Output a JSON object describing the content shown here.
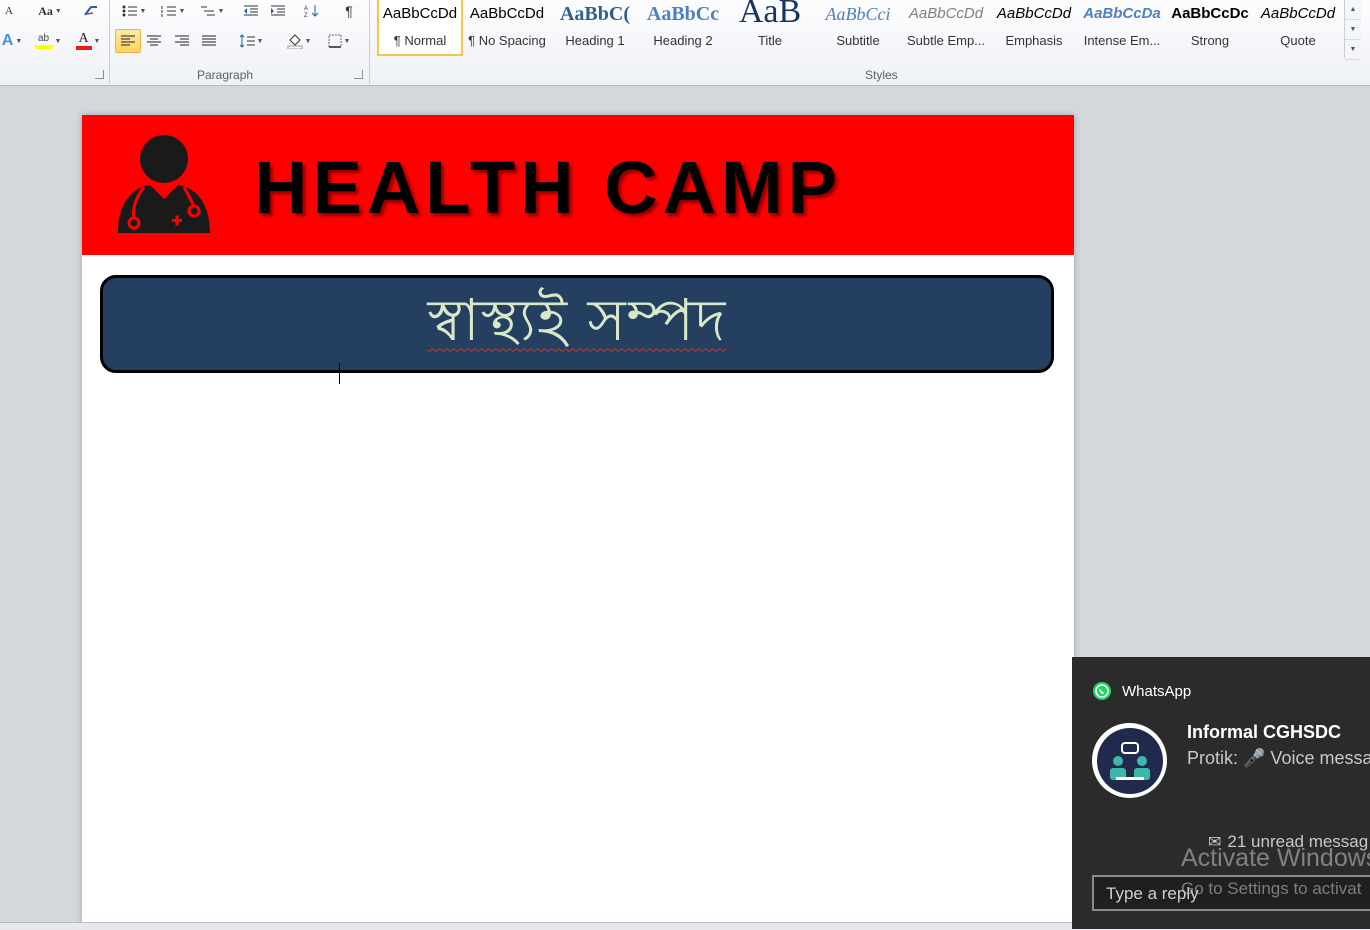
{
  "ribbon": {
    "paragraph_group_label": "Paragraph",
    "styles_group_label": "Styles",
    "font_tool_labels": {
      "grow_font": "A",
      "change_case": "Aa",
      "highlight": "ab",
      "font_color": "A",
      "pilcrow": "¶"
    },
    "styles": [
      {
        "sample": "AaBbCcDd",
        "name": "¶ Normal"
      },
      {
        "sample": "AaBbCcDd",
        "name": "¶ No Spacing"
      },
      {
        "sample": "AaBbC(",
        "name": "Heading 1"
      },
      {
        "sample": "AaBbCc",
        "name": "Heading 2"
      },
      {
        "sample": "AaB",
        "name": "Title"
      },
      {
        "sample": "AaBbCci",
        "name": "Subtitle"
      },
      {
        "sample": "AaBbCcDd",
        "name": "Subtle Emp..."
      },
      {
        "sample": "AaBbCcDd",
        "name": "Emphasis"
      },
      {
        "sample": "AaBbCcDa",
        "name": "Intense Em..."
      },
      {
        "sample": "AaBbCcDc",
        "name": "Strong"
      },
      {
        "sample": "AaBbCcDd",
        "name": "Quote"
      }
    ],
    "selected_style": "¶ Normal"
  },
  "document": {
    "banner_title": "HEALTH CAMP",
    "motto": "স্বাস্থ্যই সম্পদ",
    "colors": {
      "banner_bg": "#ff0000",
      "motto_box_bg": "#243f60",
      "motto_text": "#d8e8c8"
    },
    "icons": {
      "banner": "doctor-icon"
    }
  },
  "notification": {
    "app_name": "WhatsApp",
    "title": "Informal CGHSDC",
    "message": "Protik: 🎤 Voice messa",
    "unread": "21 unread messag",
    "reply_placeholder": "Type a reply",
    "icons": [
      "whatsapp-icon",
      "group-avatar-icon",
      "microphone-icon",
      "envelope-icon"
    ]
  },
  "watermark": {
    "line1": "Activate Windows",
    "line2": "Go to Settings to activat"
  }
}
